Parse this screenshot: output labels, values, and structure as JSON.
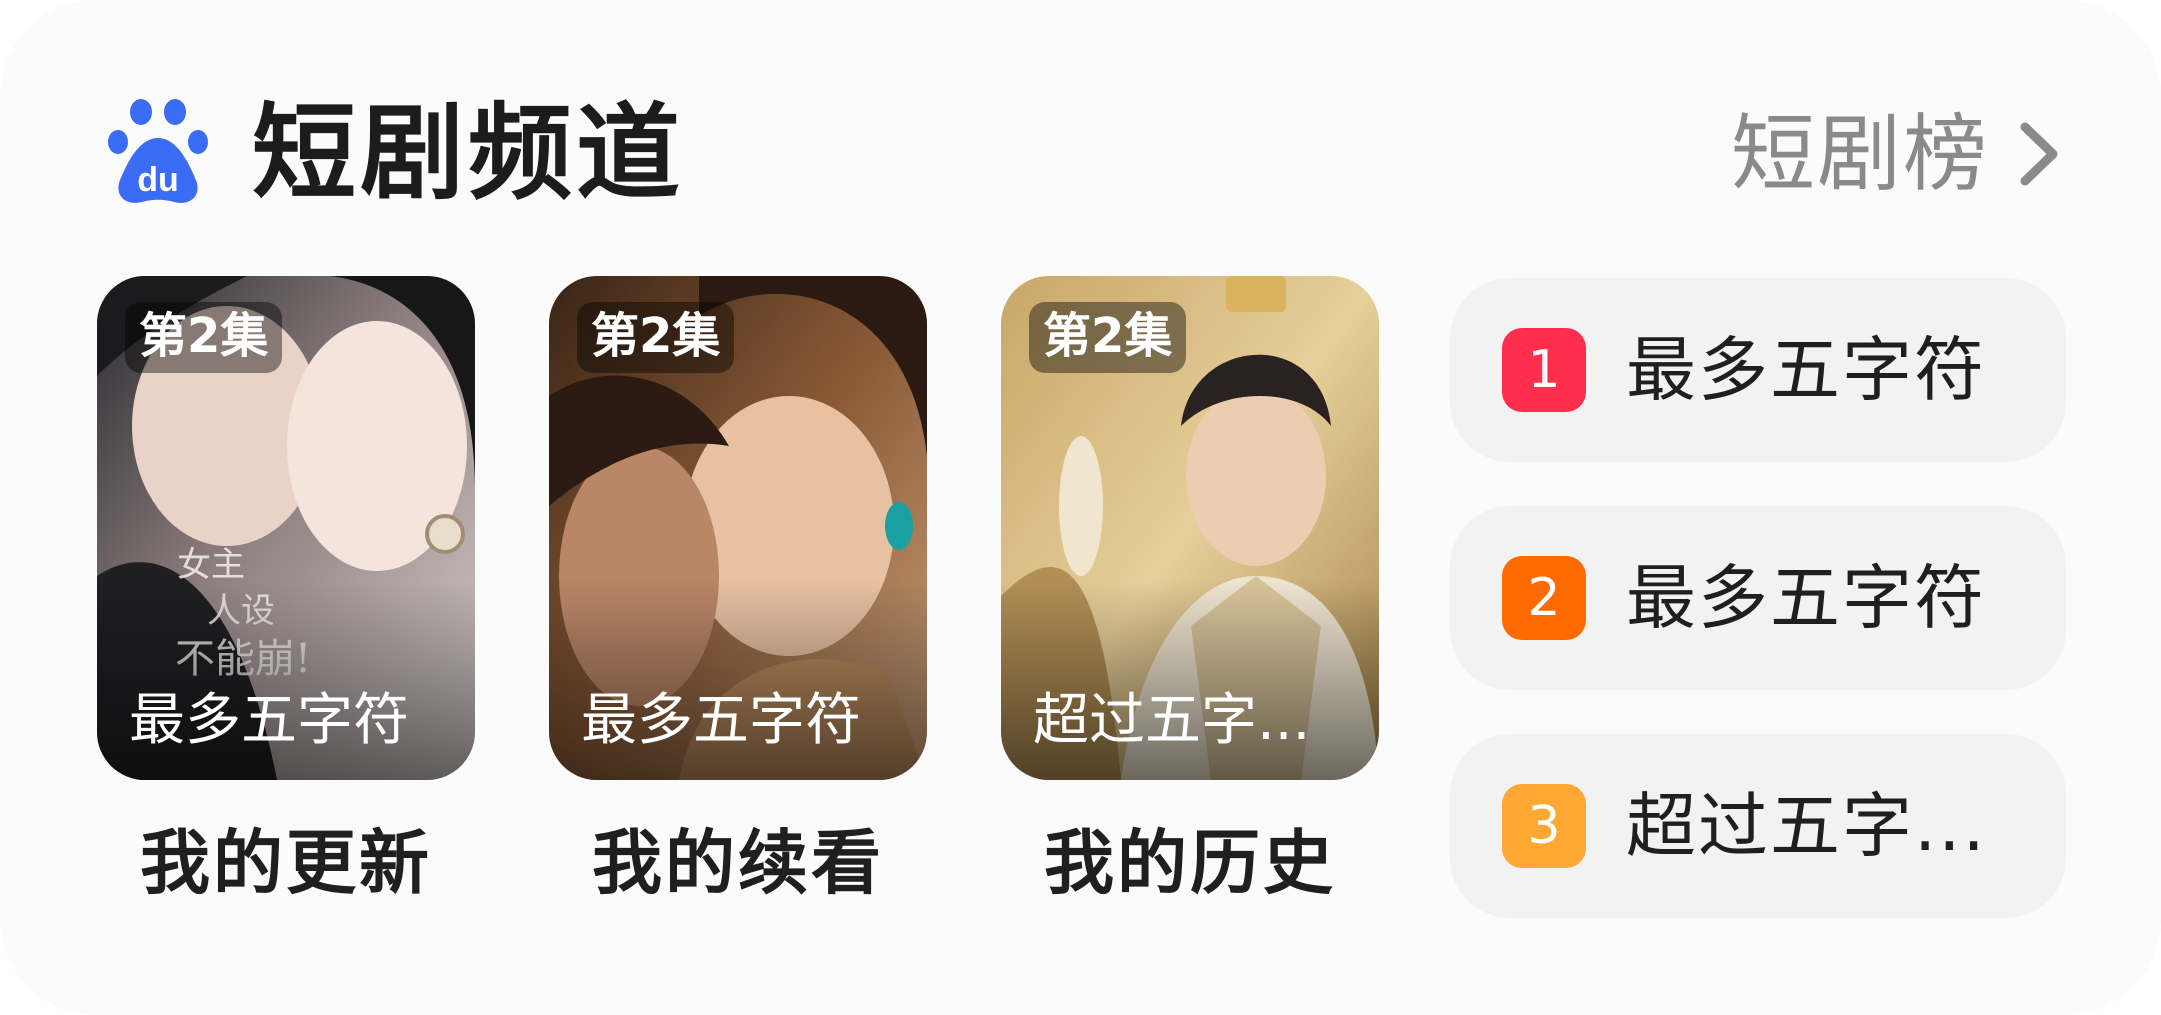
{
  "header": {
    "title": "短剧频道",
    "rank_link_label": "短剧榜"
  },
  "cards": [
    {
      "episode": "第2集",
      "poster_title": "最多五字符",
      "label": "我的更新",
      "poster_text": "女主 人设 不能崩!"
    },
    {
      "episode": "第2集",
      "poster_title": "最多五字符",
      "label": "我的续看"
    },
    {
      "episode": "第2集",
      "poster_title": "超过五字...",
      "label": "我的历史"
    }
  ],
  "ranking": [
    {
      "rank": "1",
      "title": "最多五字符",
      "color": "#ff2e4d"
    },
    {
      "rank": "2",
      "title": "最多五字符",
      "color": "#ff6a00"
    },
    {
      "rank": "3",
      "title": "超过五字...",
      "color": "#ffa733"
    }
  ],
  "colors": {
    "brand_blue": "#3b6cf6",
    "title_text": "#1c1c1c",
    "link_gray": "#8a8a8a"
  },
  "icons": {
    "logo": "baidu-paw-logo",
    "chevron": "chevron-right-icon"
  }
}
